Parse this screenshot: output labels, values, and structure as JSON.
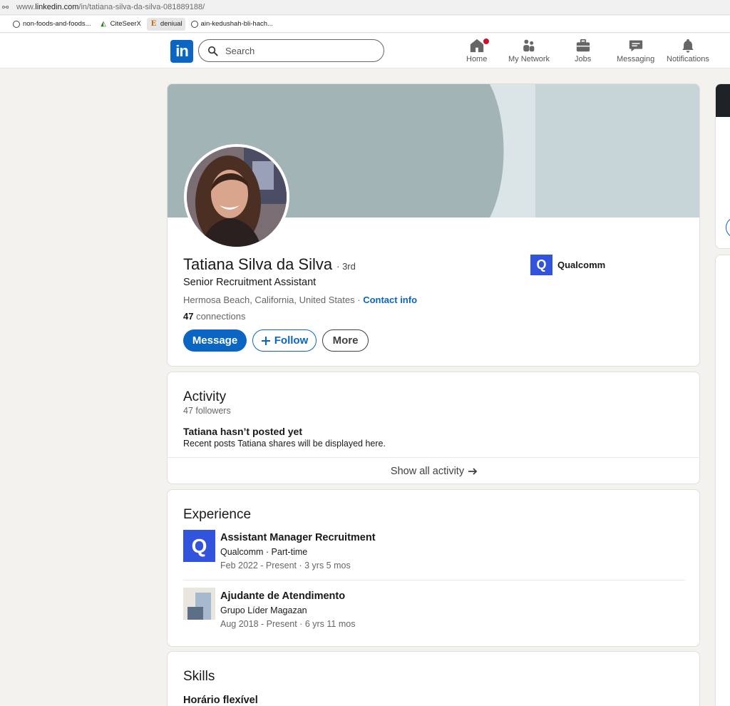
{
  "browser": {
    "url_prefix": "www.",
    "url_host": "linkedin.com",
    "url_path": "/in/tatiana-silva-da-silva-081889188/",
    "bookmarks": [
      {
        "label": "non-foods-and-foods..."
      },
      {
        "label": "CiteSeerX"
      },
      {
        "label": "deniual"
      },
      {
        "label": "ain-kedushah-bli-hach..."
      }
    ]
  },
  "nav": {
    "logo": "in",
    "search_placeholder": "Search",
    "items": [
      {
        "label": "Home",
        "icon": "home-icon"
      },
      {
        "label": "My Network",
        "icon": "network-icon"
      },
      {
        "label": "Jobs",
        "icon": "briefcase-icon"
      },
      {
        "label": "Messaging",
        "icon": "messaging-icon"
      },
      {
        "label": "Notifications",
        "icon": "bell-icon"
      }
    ]
  },
  "profile": {
    "name": "Tatiana Silva da Silva",
    "degree": "· 3rd",
    "headline": "Senior Recruitment Assistant",
    "location": "Hermosa Beach, California, United States",
    "location_sep": " · ",
    "contact_info": "Contact info",
    "connections_count": "47",
    "connections_label": " connections",
    "company": "Qualcomm",
    "buttons": {
      "message": "Message",
      "follow": "Follow",
      "more": "More"
    }
  },
  "activity": {
    "title": "Activity",
    "followers": "47 followers",
    "empty_title": "Tatiana hasn’t posted yet",
    "empty_text": "Recent posts Tatiana shares will be displayed here.",
    "show_all": "Show all activity"
  },
  "experience": {
    "title": "Experience",
    "items": [
      {
        "role": "Assistant Manager Recruitment",
        "company": "Qualcomm · Part-time",
        "dates": "Feb 2022 - Present · 3 yrs 5 mos"
      },
      {
        "role": "Ajudante de Atendimento",
        "company": "Grupo Líder Magazan",
        "dates": "Aug 2018 - Present · 6 yrs 11 mos"
      }
    ]
  },
  "skills": {
    "title": "Skills",
    "items": [
      {
        "name": "Horário flexível"
      }
    ]
  },
  "colors": {
    "brand": "#0a66c2",
    "badge": "#cb112d",
    "qualcomm": "#3253dc",
    "background": "#f4f2ee"
  }
}
